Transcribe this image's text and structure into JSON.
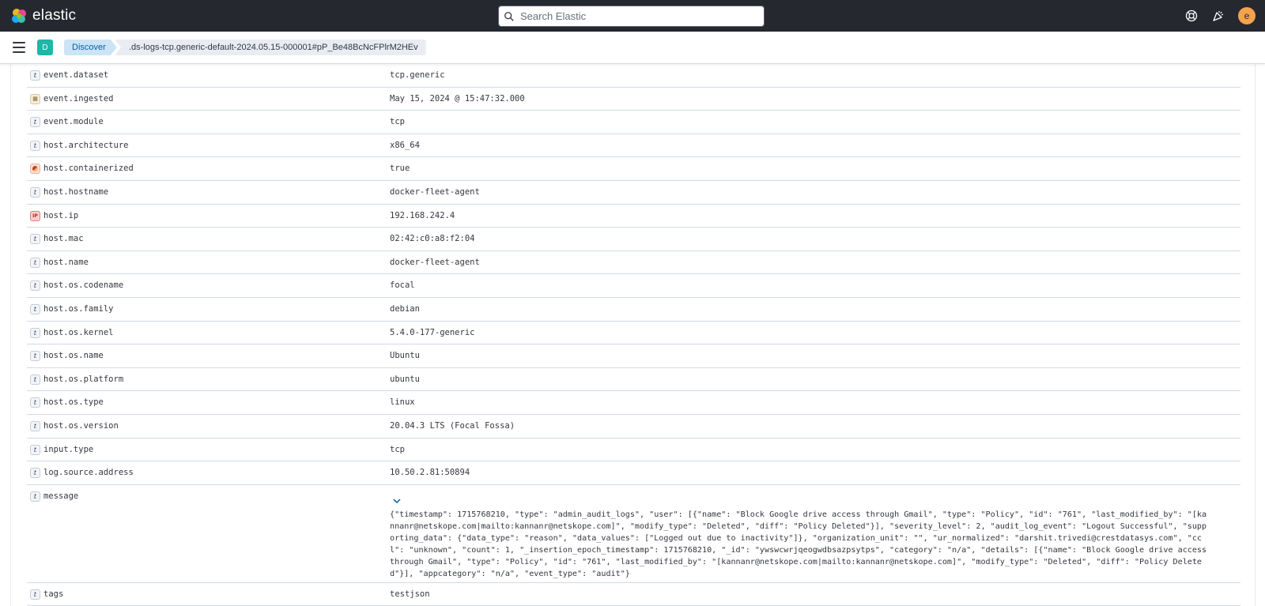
{
  "header": {
    "brand": "elastic",
    "search_placeholder": "Search Elastic",
    "avatar_initial": "e"
  },
  "nav": {
    "space_badge": "D",
    "breadcrumbs": [
      "Discover",
      ".ds-logs-tcp.generic-default-2024.05.15-000001#pP_Be48BcNcFPlrM2HEv"
    ]
  },
  "fields": [
    {
      "type": "string",
      "name": "event.dataset",
      "value": "tcp.generic"
    },
    {
      "type": "date",
      "name": "event.ingested",
      "value": "May 15, 2024 @ 15:47:32.000"
    },
    {
      "type": "string",
      "name": "event.module",
      "value": "tcp"
    },
    {
      "type": "string",
      "name": "host.architecture",
      "value": "x86_64"
    },
    {
      "type": "boolean",
      "name": "host.containerized",
      "value": "true"
    },
    {
      "type": "string",
      "name": "host.hostname",
      "value": "docker-fleet-agent"
    },
    {
      "type": "ip",
      "name": "host.ip",
      "value": "192.168.242.4"
    },
    {
      "type": "string",
      "name": "host.mac",
      "value": "02:42:c0:a8:f2:04"
    },
    {
      "type": "string",
      "name": "host.name",
      "value": "docker-fleet-agent"
    },
    {
      "type": "string",
      "name": "host.os.codename",
      "value": "focal"
    },
    {
      "type": "string",
      "name": "host.os.family",
      "value": "debian"
    },
    {
      "type": "string",
      "name": "host.os.kernel",
      "value": "5.4.0-177-generic"
    },
    {
      "type": "string",
      "name": "host.os.name",
      "value": "Ubuntu"
    },
    {
      "type": "string",
      "name": "host.os.platform",
      "value": "ubuntu"
    },
    {
      "type": "string",
      "name": "host.os.type",
      "value": "linux"
    },
    {
      "type": "string",
      "name": "host.os.version",
      "value": "20.04.3 LTS (Focal Fossa)"
    },
    {
      "type": "string",
      "name": "input.type",
      "value": "tcp"
    },
    {
      "type": "string",
      "name": "log.source.address",
      "value": "10.50.2.81:50894"
    }
  ],
  "message_field": {
    "type": "string",
    "name": "message",
    "value": "{\"timestamp\": 1715768210, \"type\": \"admin_audit_logs\", \"user\": [{\"name\": \"Block Google drive access through Gmail\", \"type\": \"Policy\", \"id\": \"761\", \"last_modified_by\": \"[kannanr@netskope.com|mailto:kannanr@netskope.com]\", \"modify_type\": \"Deleted\", \"diff\": \"Policy Deleted\"}], \"severity_level\": 2, \"audit_log_event\": \"Logout Successful\", \"supporting_data\": {\"data_type\": \"reason\", \"data_values\": [\"Logged out due to inactivity\"]}, \"organization_unit\": \"\", \"ur_normalized\": \"darshit.trivedi@crestdatasys.com\", \"ccl\": \"unknown\", \"count\": 1, \"_insertion_epoch_timestamp\": 1715768210, \"_id\": \"ywswcwrjqeogwdbsazpsytps\", \"category\": \"n/a\", \"details\": [{\"name\": \"Block Google drive access through Gmail\", \"type\": \"Policy\", \"id\": \"761\", \"last_modified_by\": \"[kannanr@netskope.com|mailto:kannanr@netskope.com]\", \"modify_type\": \"Deleted\", \"diff\": \"Policy Deleted\"}], \"appcategory\": \"n/a\", \"event_type\": \"audit\"}"
  },
  "tags_field": {
    "type": "string",
    "name": "tags",
    "value": "testjson"
  },
  "colors": {
    "header_bg": "#25282f",
    "accent": "#0061a6",
    "space_badge": "#1fb5a7",
    "avatar": "#f3a24d"
  }
}
